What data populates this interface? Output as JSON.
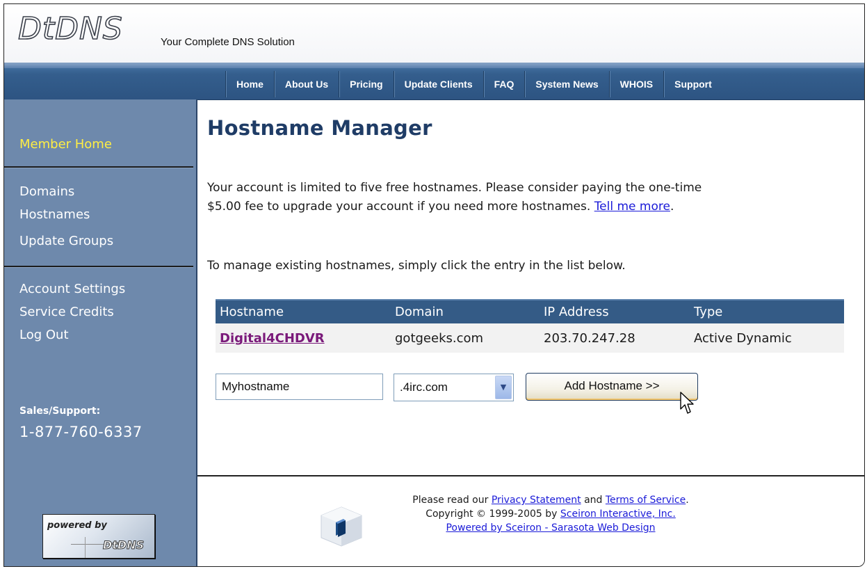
{
  "header": {
    "logo_text": "DtDNS",
    "tagline": "Your Complete DNS Solution"
  },
  "nav": {
    "items": [
      "Home",
      "About Us",
      "Pricing",
      "Update Clients",
      "FAQ",
      "System News",
      "WHOIS",
      "Support"
    ]
  },
  "sidebar": {
    "member_home": "Member Home",
    "group1": [
      "Domains",
      "Hostnames",
      "Update Groups"
    ],
    "group2": [
      "Account Settings",
      "Service Credits",
      "Log Out"
    ],
    "sales_label": "Sales/Support:",
    "sales_phone": "1-877-760-6337",
    "badge_top": "powered by",
    "badge_bottom": "DtDNS"
  },
  "main": {
    "title": "Hostname Manager",
    "intro_line1": "Your account is limited to five free hostnames. Please consider paying the one-time",
    "intro_line2": "$5.00 fee to upgrade your account if you need more hostnames. ",
    "tell_me_more": "Tell me more",
    "intro_end": ".",
    "instructions": "To manage existing hostnames, simply click the entry in the list below.",
    "table": {
      "headers": [
        "Hostname",
        "Domain",
        "IP Address",
        "Type"
      ],
      "rows": [
        {
          "hostname": "Digital4CHDVR",
          "domain": "gotgeeks.com",
          "ip": "203.70.247.28",
          "type": "Active Dynamic"
        }
      ]
    },
    "form": {
      "hostname_value": "Myhostname",
      "domain_selected": ".4irc.com",
      "add_button": "Add Hostname >>"
    }
  },
  "footer": {
    "line1_pre": "Please read our ",
    "privacy": "Privacy Statement",
    "line1_mid": " and ",
    "terms": "Terms of Service",
    "line1_end": ".",
    "line2_pre": "Copyright © 1999-2005 by ",
    "company": "Sceiron Interactive, Inc.",
    "line3": "Powered by Sceiron - Sarasota Web Design"
  },
  "colors": {
    "nav_bar": "#345e8d",
    "sidebar": "#6e89ac",
    "member_home": "#ffee44",
    "title": "#1f3c66",
    "table_header": "#345b86",
    "link": "#1a1ad8",
    "visited_link": "#7a1a7a"
  },
  "icons": {
    "cube": "cube-logo-icon",
    "cursor": "mouse-pointer-icon",
    "dropdown": "chevron-down-icon"
  }
}
